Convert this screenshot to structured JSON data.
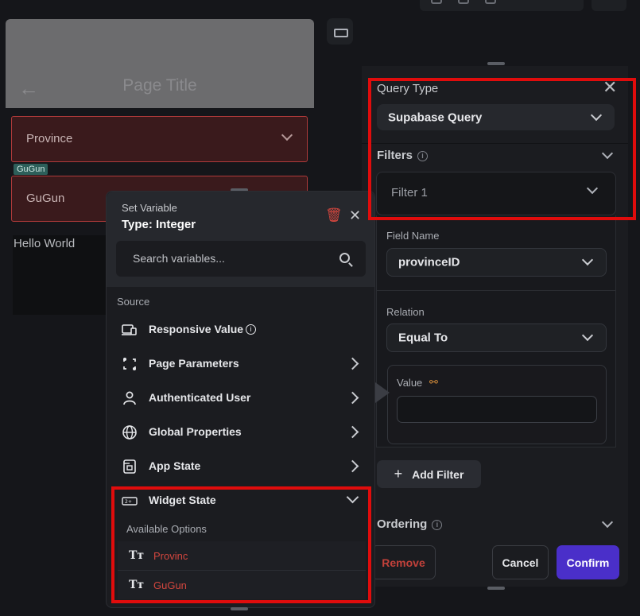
{
  "canvas": {
    "page_title": "Page Title",
    "province_label": "Province",
    "gugun_tag": "GuGun",
    "gugun_label": "GuGun",
    "hello_text": "Hello World"
  },
  "query_panel": {
    "query_type_label": "Query Type",
    "query_type_value": "Supabase Query",
    "filters_label": "Filters",
    "filter_name": "Filter 1",
    "field_name_label": "Field Name",
    "field_name_value": "provinceID",
    "relation_label": "Relation",
    "relation_value": "Equal To",
    "value_label": "Value",
    "add_filter_label": "Add Filter",
    "ordering_label": "Ordering",
    "remove_label": "Remove",
    "cancel_label": "Cancel",
    "confirm_label": "Confirm"
  },
  "set_variable": {
    "heading": "Set Variable",
    "type_label": "Type: Integer",
    "search_placeholder": "Search variables...",
    "source_label": "Source",
    "sources": [
      {
        "label": "Responsive Value",
        "icon": "devices-icon"
      },
      {
        "label": "Page Parameters",
        "icon": "page-params-icon"
      },
      {
        "label": "Authenticated User",
        "icon": "user-icon"
      },
      {
        "label": "Global Properties",
        "icon": "globe-icon"
      },
      {
        "label": "App State",
        "icon": "app-state-icon"
      },
      {
        "label": "Widget State",
        "icon": "widget-state-icon"
      }
    ],
    "available_options_label": "Available Options",
    "options": [
      "Provinc",
      "GuGun"
    ]
  },
  "colors": {
    "accent": "#4a2fc9",
    "highlight": "#e00c0c",
    "danger_text": "#d2463e"
  }
}
